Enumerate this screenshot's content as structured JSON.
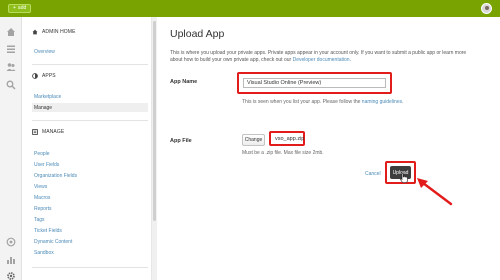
{
  "topbar": {
    "add_label": "add",
    "accent": "#78a300"
  },
  "sidebar": {
    "admin_home": "ADMIN HOME",
    "overview": "Overview",
    "apps_heading": "APPS",
    "marketplace": "Marketplace",
    "manage": "Manage",
    "manage_heading": "MANAGE",
    "manage_items": [
      "People",
      "User Fields",
      "Organization Fields",
      "Views",
      "Macros",
      "Reports",
      "Tags",
      "Ticket Fields",
      "Dynamic Content",
      "Sandbox"
    ]
  },
  "main": {
    "title": "Upload App",
    "intro_text": "This is where you upload your private apps. Private apps appear in your account only. If you want to submit a public app or learn more about how to build your own private app, check out our ",
    "intro_link": "Developer documentation",
    "intro_end": ".",
    "app_name_label": "App Name",
    "app_name_value": "Visual Studio Online (Preview)",
    "app_name_hint": "This is seen when you list your app. Please follow the ",
    "app_name_hint_link": "naming guidelines",
    "app_name_hint_end": ".",
    "app_file_label": "App File",
    "change_label": "Change",
    "file_name": "vso_app.zip",
    "file_hint": "Must be a .zip file. Max file size 2mb.",
    "cancel_label": "Cancel",
    "upload_label": "Upload",
    "highlight_color": "#e21b1b"
  }
}
